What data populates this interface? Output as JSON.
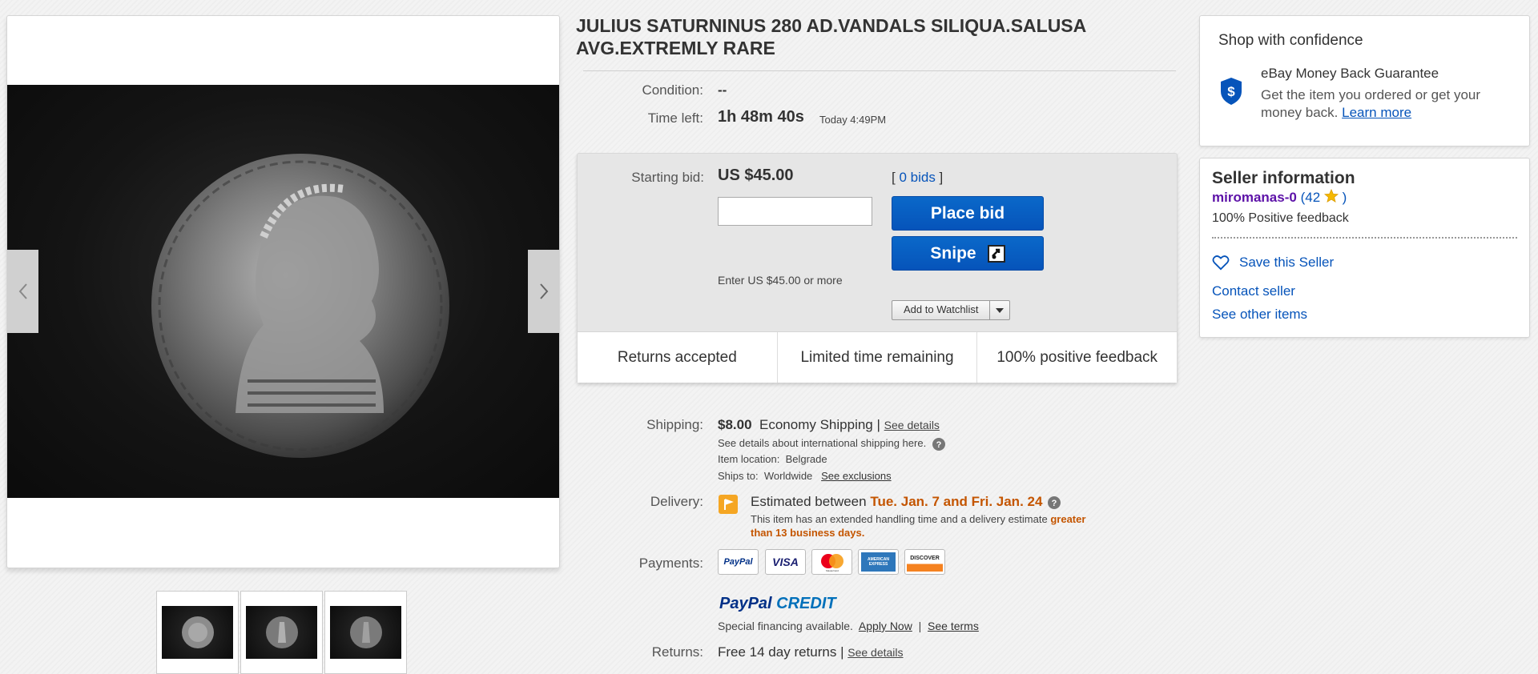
{
  "listing": {
    "title": "JULIUS SATURNINUS 280 AD.VANDALS SILIQUA.SALUSA AVG.EXTREMLY RARE",
    "condition_label": "Condition:",
    "condition_value": "--",
    "time_left_label": "Time left:",
    "time_left_value": "1h 48m 40s",
    "end_time": "Today 4:49PM"
  },
  "image_viewer": {
    "prev_icon": "chevron-left-icon",
    "next_icon": "chevron-right-icon",
    "thumbnails": [
      "coin-obverse",
      "coin-reverse",
      "coin-reverse-2"
    ]
  },
  "bid": {
    "starting_label": "Starting bid:",
    "price": "US $45.00",
    "bids_open": "[ ",
    "bids_count": "0 bids",
    "bids_close": " ]",
    "input_value": "",
    "hint": "Enter US $45.00 or more",
    "place_bid": "Place bid",
    "snipe": "Snipe",
    "watchlist": "Add to Watchlist"
  },
  "badges": [
    "Returns accepted",
    "Limited time remaining",
    "100% positive feedback"
  ],
  "shipping": {
    "label": "Shipping:",
    "price": "$8.00",
    "method": "Economy Shipping",
    "sep": "|",
    "details_link": "See details",
    "intl": "See details about international shipping here.",
    "location_label": "Item location:",
    "location": "Belgrade",
    "ships_to_label": "Ships to:",
    "ships_to": "Worldwide",
    "exclusions_link": "See exclusions"
  },
  "delivery": {
    "label": "Delivery:",
    "estimated": "Estimated between",
    "dates": "Tue. Jan. 7 and Fri. Jan. 24",
    "note": "This item has an extended handling time and a delivery estimate",
    "note_highlight1": "greater",
    "note_highlight2": "than 13 business days."
  },
  "payments": {
    "label": "Payments:",
    "cards": [
      "PayPal",
      "VISA",
      "MasterCard",
      "AMERICAN EXPRESS",
      "DISCOVER"
    ],
    "credit_brand1": "PayPal",
    "credit_brand2": "CREDIT",
    "financing": "Special financing available.",
    "apply_now": "Apply Now",
    "sep": "|",
    "see_terms": "See terms"
  },
  "returns": {
    "label": "Returns:",
    "value": "Free 14 day returns",
    "sep": "|",
    "details_link": "See details"
  },
  "confidence": {
    "title": "Shop with confidence",
    "guarantee_title": "eBay Money Back Guarantee",
    "guarantee_text": "Get the item you ordered or get your money back.",
    "learn_more": "Learn more"
  },
  "seller": {
    "title": "Seller information",
    "name": "miromanas-0",
    "score_open": "(",
    "score": "42",
    "score_close": ")",
    "feedback": "100% Positive feedback",
    "save_seller": "Save this Seller",
    "contact": "Contact seller",
    "other_items": "See other items"
  },
  "colors": {
    "accent_blue": "#0654ba",
    "delivery_orange": "#c45500",
    "seller_purple": "#5d12a8",
    "star_yellow": "#f5b800"
  }
}
